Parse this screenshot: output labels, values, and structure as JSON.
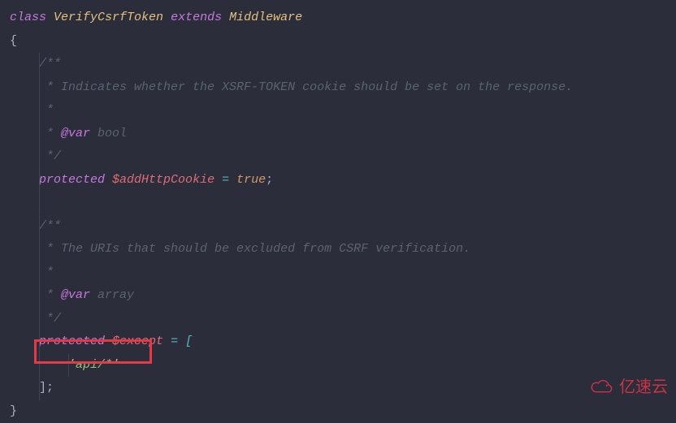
{
  "code": {
    "l1": {
      "kw1": "class",
      "cls1": "VerifyCsrfToken",
      "kw2": "extends",
      "cls2": "Middleware"
    },
    "l2": "{",
    "c1_open": "/**",
    "c1_l1": " * Indicates whether the XSRF-TOKEN cookie should be set on the response.",
    "c1_l2": " *",
    "c1_l3_star": " * ",
    "c1_l3_tag": "@var",
    "c1_l3_type": " bool",
    "c1_close": " */",
    "prop1_kw": "protected",
    "prop1_name": "$addHttpCookie",
    "prop1_eq": " = ",
    "prop1_val": "true",
    "prop1_semi": ";",
    "c2_open": "/**",
    "c2_l1": " * The URIs that should be excluded from CSRF verification.",
    "c2_l2": " *",
    "c2_l3_star": " * ",
    "c2_l3_tag": "@var",
    "c2_l3_type": " array",
    "c2_close": " */",
    "prop2_kw": "protected",
    "prop2_name": "$except",
    "prop2_eq": " = [",
    "except_val": "'api/*'",
    "except_close": "];",
    "lend": "}"
  },
  "watermark": "亿速云"
}
